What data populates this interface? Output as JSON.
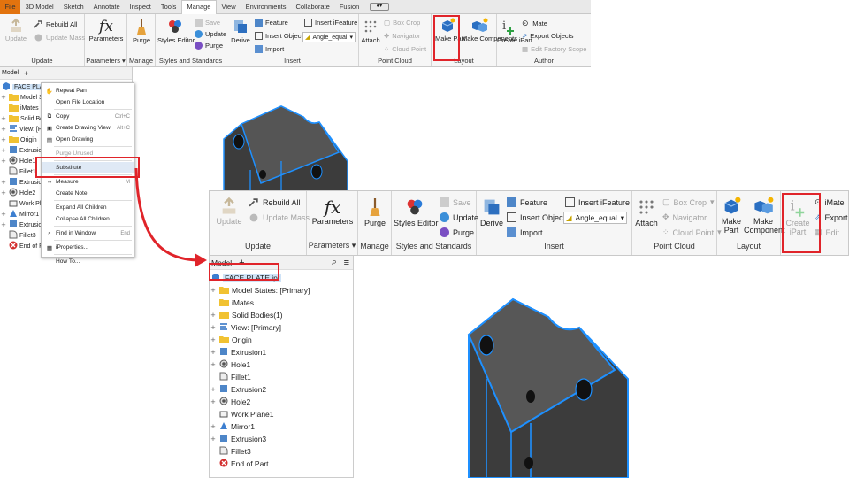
{
  "ribbon_tabs": [
    "File",
    "3D Model",
    "Sketch",
    "Annotate",
    "Inspect",
    "Tools",
    "Manage",
    "View",
    "Environments",
    "Collaborate",
    "Fusion"
  ],
  "active_tab": "Manage",
  "ribbon_small": {
    "update": "Update",
    "rebuild_all": "Rebuild All",
    "update_mass": "Update Mass",
    "update_panel": "Update",
    "parameters": "Parameters",
    "parameters_panel": "Parameters",
    "purge": "Purge",
    "manage_panel": "Manage",
    "styles_editor": "Styles Editor",
    "save": "Save",
    "update2": "Update",
    "purge2": "Purge",
    "styles_panel": "Styles and Standards",
    "derive": "Derive",
    "feature": "Feature",
    "insert_object": "Insert Object",
    "import": "Import",
    "insert_ifeature": "Insert iFeature",
    "angle_value": "Angle_equal",
    "insert_panel": "Insert",
    "attach": "Attach",
    "box_crop": "Box Crop",
    "navigator": "Navigator",
    "cloud_point": "Cloud Point",
    "point_cloud_panel": "Point Cloud",
    "make_part": "Make Part",
    "make_components": "Make Components",
    "layout_panel": "Layout",
    "create_ipart": "Create iPart",
    "imate": "iMate",
    "export_objects": "Export Objects",
    "edit_factory_scope": "Edit Factory Scope",
    "author_panel": "Author"
  },
  "ribbon_large": {
    "update": "Update",
    "rebuild_all": "Rebuild All",
    "update_mass": "Update Mass",
    "update_panel": "Update",
    "parameters": "Parameters",
    "parameters_panel": "Parameters",
    "purge": "Purge",
    "manage_panel": "Manage",
    "styles_editor": "Styles Editor",
    "save": "Save",
    "update2": "Update",
    "purge2": "Purge",
    "styles_panel": "Styles and Standards",
    "derive": "Derive",
    "feature": "Feature",
    "insert_object": "Insert Object",
    "import": "Import",
    "insert_ifeature": "Insert iFeature",
    "angle_value": "Angle_equal",
    "insert_panel": "Insert",
    "attach": "Attach",
    "box_crop": "Box Crop",
    "navigator": "Navigator",
    "cloud_point": "Cloud Point",
    "point_cloud_panel": "Point Cloud",
    "make_part": "Make Part",
    "make_components": "Make Component",
    "layout_panel": "Layout",
    "create_ipart": "Create iPart",
    "imate": "iMate",
    "export": "Export",
    "edit": "Edit"
  },
  "browser_small": {
    "tab": "Model",
    "items": [
      "FACE PLATE",
      "Model Sta",
      "iMates",
      "Solid Bodi",
      "View: [Pri",
      "Origin",
      "Extrusion",
      "Hole1",
      "Fillet1",
      "Extrusion",
      "Hole2",
      "Work Plane",
      "Mirror1",
      "Extrusion",
      "Fillet3",
      "End of Pa"
    ]
  },
  "context_menu": {
    "items": [
      {
        "label": "Repeat Pan",
        "shortcut": ""
      },
      {
        "label": "Open File Location",
        "shortcut": ""
      },
      {
        "label": "Copy",
        "shortcut": "Ctrl+C"
      },
      {
        "label": "Create Drawing View",
        "shortcut": "Alt+C"
      },
      {
        "label": "Open Drawing",
        "shortcut": ""
      },
      {
        "label": "Purge Unused",
        "shortcut": ""
      },
      {
        "label": "Substitute",
        "shortcut": ""
      },
      {
        "label": "Measure",
        "shortcut": "M"
      },
      {
        "label": "Create Note",
        "shortcut": ""
      },
      {
        "label": "Expand All Children",
        "shortcut": ""
      },
      {
        "label": "Collapse All Children",
        "shortcut": ""
      },
      {
        "label": "Find in Window",
        "shortcut": "End"
      },
      {
        "label": "iProperties...",
        "shortcut": ""
      },
      {
        "label": "How To...",
        "shortcut": ""
      }
    ]
  },
  "browser_large": {
    "tab": "Model",
    "items": [
      "FACE PLATE.ipt",
      "Model States: [Primary]",
      "iMates",
      "Solid Bodies(1)",
      "View: [Primary]",
      "Origin",
      "Extrusion1",
      "Hole1",
      "Fillet1",
      "Extrusion2",
      "Hole2",
      "Work Plane1",
      "Mirror1",
      "Extrusion3",
      "Fillet3",
      "End of Part"
    ]
  },
  "colors": {
    "highlight": "#e0242a",
    "file_tab": "#e2730e",
    "part_edge": "#1e90ff",
    "part_body": "#4a4a4a",
    "selection": "#cfe3f7"
  }
}
